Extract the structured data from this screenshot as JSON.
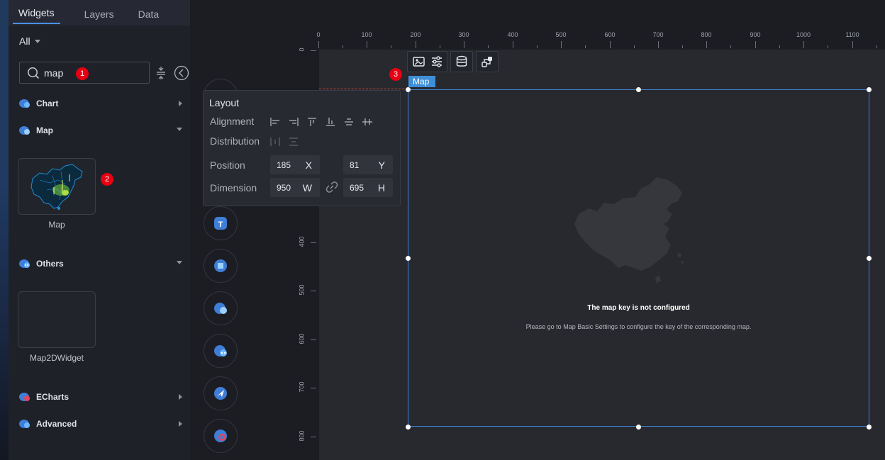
{
  "tabs": [
    {
      "label": "Widgets",
      "active": true
    },
    {
      "label": "Layers",
      "active": false
    },
    {
      "label": "Data",
      "active": false
    }
  ],
  "filter": {
    "label": "All"
  },
  "search": {
    "value": "map"
  },
  "badges": [
    "1",
    "2",
    "3"
  ],
  "categories": {
    "chart": "Chart",
    "map": "Map",
    "others": "Others",
    "echarts": "ECharts",
    "advanced": "Advanced"
  },
  "widgets": {
    "map_card": "Map",
    "map2d_card": "Map2DWidget"
  },
  "ruler": {
    "top": [
      "0",
      "100",
      "200",
      "300",
      "400",
      "500",
      "600",
      "700",
      "800",
      "900",
      "1000",
      "1100"
    ],
    "left": [
      "0",
      "400",
      "500",
      "600",
      "700",
      "800"
    ]
  },
  "layout_panel": {
    "title": "Layout",
    "alignment_label": "Alignment",
    "distribution_label": "Distribution",
    "position_label": "Position",
    "dimension_label": "Dimension",
    "x_value": "185",
    "x_unit": "X",
    "y_value": "81",
    "y_unit": "Y",
    "w_value": "950",
    "w_unit": "W",
    "h_value": "695",
    "h_unit": "H"
  },
  "canvas": {
    "widget_tag": "Map",
    "message_title": "The map key is not configured",
    "message_body": "Please go to Map Basic Settings to configure the key of the corresponding map."
  },
  "colors": {
    "accent": "#3e8ed8",
    "badge": "#e60012",
    "panel_bg": "#1f2129",
    "canvas_bg": "#28292e"
  }
}
